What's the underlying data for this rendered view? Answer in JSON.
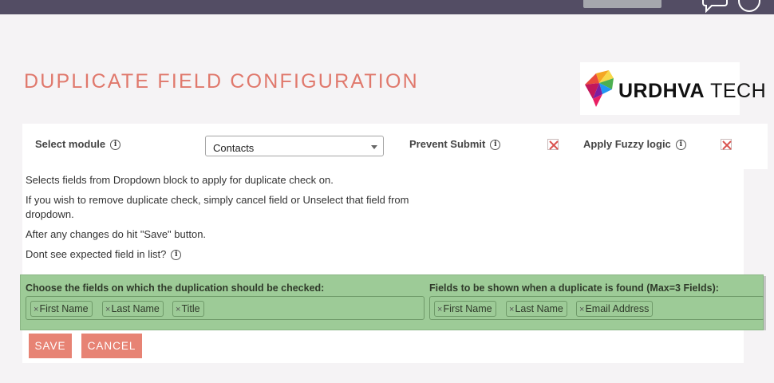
{
  "header": {
    "title": "DUPLICATE FIELD CONFIGURATION"
  },
  "logo": {
    "text_bold": "URDHVA",
    "text_light": " TECH"
  },
  "icons": {
    "topbar_chat": "chat-bubble-icon",
    "topbar_help": "help-circle-icon",
    "info": "info-icon",
    "remove": "close-icon",
    "checkbox_x": "x-mark-icon"
  },
  "colors": {
    "title": "#e0786c",
    "topbar": "#534d64",
    "button": "#e78374",
    "selection_bg": "#9dcb97",
    "x_mark": "#d9534f"
  },
  "config": {
    "module_label": "Select module",
    "module_value": "Contacts",
    "prevent_label": "Prevent Submit",
    "fuzzy_label": "Apply Fuzzy logic",
    "info_glyph": "i"
  },
  "help": {
    "line1": "Selects fields from Dropdown block to apply for duplicate check on.",
    "line2": "If you wish to remove duplicate check, simply cancel field or Unselect that field from",
    "line3": "dropdown.",
    "line4": "After any changes do hit \"Save\" button.",
    "line5": "Dont see expected field in list?"
  },
  "check_fields": {
    "label": "Choose the fields on which the duplication should be checked:",
    "tags": [
      "First Name",
      "Last Name",
      "Title"
    ]
  },
  "show_fields": {
    "label": "Fields to be shown when a duplicate is found (Max=3 Fields):",
    "tags": [
      "First Name",
      "Last Name",
      "Email Address"
    ]
  },
  "actions": {
    "save": "SAVE",
    "cancel": "CANCEL",
    "remove_glyph": "×"
  }
}
